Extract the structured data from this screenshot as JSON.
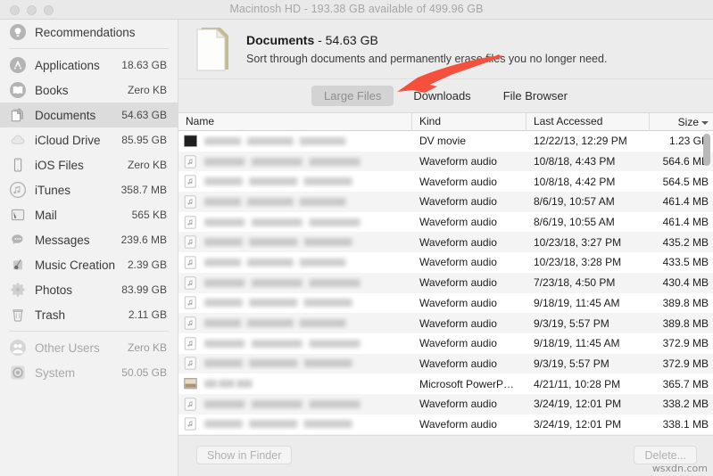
{
  "window": {
    "title": "Macintosh HD - 193.38 GB available of 499.96 GB",
    "traffic_lights": [
      "close",
      "minimize",
      "zoom"
    ],
    "accent_annotation_color": "#f4503c",
    "selection_color": "#dcdcdc"
  },
  "sidebar": {
    "items": [
      {
        "label": "Recommendations",
        "size": "",
        "icon": "lightbulb-icon",
        "selected": false,
        "dim": false,
        "divider_after": true
      },
      {
        "label": "Applications",
        "size": "18.63 GB",
        "icon": "app-store-icon",
        "selected": false,
        "dim": false,
        "divider_after": false
      },
      {
        "label": "Books",
        "size": "Zero KB",
        "icon": "book-icon",
        "selected": false,
        "dim": false,
        "divider_after": false
      },
      {
        "label": "Documents",
        "size": "54.63 GB",
        "icon": "documents-icon",
        "selected": true,
        "dim": false,
        "divider_after": false
      },
      {
        "label": "iCloud Drive",
        "size": "85.95 GB",
        "icon": "cloud-icon",
        "selected": false,
        "dim": false,
        "divider_after": false
      },
      {
        "label": "iOS Files",
        "size": "Zero KB",
        "icon": "iphone-icon",
        "selected": false,
        "dim": false,
        "divider_after": false
      },
      {
        "label": "iTunes",
        "size": "358.7 MB",
        "icon": "music-note-icon",
        "selected": false,
        "dim": false,
        "divider_after": false
      },
      {
        "label": "Mail",
        "size": "565 KB",
        "icon": "mail-icon",
        "selected": false,
        "dim": false,
        "divider_after": false
      },
      {
        "label": "Messages",
        "size": "239.6 MB",
        "icon": "speech-bubble-icon",
        "selected": false,
        "dim": false,
        "divider_after": false
      },
      {
        "label": "Music Creation",
        "size": "2.39 GB",
        "icon": "garageband-icon",
        "selected": false,
        "dim": false,
        "divider_after": false
      },
      {
        "label": "Photos",
        "size": "83.99 GB",
        "icon": "photos-icon",
        "selected": false,
        "dim": false,
        "divider_after": false
      },
      {
        "label": "Trash",
        "size": "2.11 GB",
        "icon": "trash-icon",
        "selected": false,
        "dim": false,
        "divider_after": true
      },
      {
        "label": "Other Users",
        "size": "Zero KB",
        "icon": "users-icon",
        "selected": false,
        "dim": true,
        "divider_after": false
      },
      {
        "label": "System",
        "size": "50.05 GB",
        "icon": "system-gear-icon",
        "selected": false,
        "dim": true,
        "divider_after": false
      }
    ]
  },
  "hero": {
    "icon": "document-file-icon",
    "title_name": "Documents",
    "title_size": " - 54.63 GB",
    "subtitle": "Sort through documents and permanently erase files you no longer need."
  },
  "tabs": [
    {
      "label": "Large Files",
      "active": true
    },
    {
      "label": "Downloads",
      "active": false
    },
    {
      "label": "File Browser",
      "active": false
    }
  ],
  "table": {
    "columns": [
      {
        "key": "name",
        "label": "Name"
      },
      {
        "key": "kind",
        "label": "Kind"
      },
      {
        "key": "date",
        "label": "Last Accessed"
      },
      {
        "key": "size",
        "label": "Size"
      }
    ],
    "sort": {
      "column": "Size",
      "direction": "descending"
    },
    "rows": [
      {
        "name": "",
        "name_redacted": true,
        "icon": "movie-thumbnail-icon",
        "kind": "DV movie",
        "date": "12/22/13, 12:29 PM",
        "size": "1.23 GB"
      },
      {
        "name": "",
        "name_redacted": true,
        "icon": "audio-file-icon",
        "kind": "Waveform audio",
        "date": "10/8/18, 4:43 PM",
        "size": "564.6 MB"
      },
      {
        "name": "",
        "name_redacted": true,
        "icon": "audio-file-icon",
        "kind": "Waveform audio",
        "date": "10/8/18, 4:42 PM",
        "size": "564.5 MB"
      },
      {
        "name": "",
        "name_redacted": true,
        "icon": "audio-file-icon",
        "kind": "Waveform audio",
        "date": "8/6/19, 10:57 AM",
        "size": "461.4 MB"
      },
      {
        "name": "",
        "name_redacted": true,
        "icon": "audio-file-icon",
        "kind": "Waveform audio",
        "date": "8/6/19, 10:55 AM",
        "size": "461.4 MB"
      },
      {
        "name": "",
        "name_redacted": true,
        "icon": "audio-file-icon",
        "kind": "Waveform audio",
        "date": "10/23/18, 3:27 PM",
        "size": "435.2 MB"
      },
      {
        "name": "",
        "name_redacted": true,
        "icon": "audio-file-icon",
        "kind": "Waveform audio",
        "date": "10/23/18, 3:28 PM",
        "size": "433.5 MB"
      },
      {
        "name": "",
        "name_redacted": true,
        "icon": "audio-file-icon",
        "kind": "Waveform audio",
        "date": "7/23/18, 4:50 PM",
        "size": "430.4 MB"
      },
      {
        "name": "",
        "name_redacted": true,
        "icon": "audio-file-icon",
        "kind": "Waveform audio",
        "date": "9/18/19, 11:45 AM",
        "size": "389.8 MB"
      },
      {
        "name": "",
        "name_redacted": true,
        "icon": "audio-file-icon",
        "kind": "Waveform audio",
        "date": "9/3/19, 5:57 PM",
        "size": "389.8 MB"
      },
      {
        "name": "",
        "name_redacted": true,
        "icon": "audio-file-icon",
        "kind": "Waveform audio",
        "date": "9/18/19, 11:45 AM",
        "size": "372.9 MB"
      },
      {
        "name": "",
        "name_redacted": true,
        "icon": "audio-file-icon",
        "kind": "Waveform audio",
        "date": "9/3/19, 5:57 PM",
        "size": "372.9 MB"
      },
      {
        "name": "",
        "name_redacted": true,
        "icon": "powerpoint-icon",
        "kind": "Microsoft PowerP…",
        "date": "4/21/11, 10:28 PM",
        "size": "365.7 MB"
      },
      {
        "name": "",
        "name_redacted": true,
        "icon": "audio-file-icon",
        "kind": "Waveform audio",
        "date": "3/24/19, 12:01 PM",
        "size": "338.2 MB"
      },
      {
        "name": "",
        "name_redacted": true,
        "icon": "audio-file-icon",
        "kind": "Waveform audio",
        "date": "3/24/19, 12:01 PM",
        "size": "338.1 MB"
      },
      {
        "name": "",
        "name_redacted": true,
        "icon": "audio-file-icon",
        "kind": "",
        "date": "",
        "size": ""
      }
    ]
  },
  "footer": {
    "show_in_finder_label": "Show in Finder",
    "delete_label": "Delete...",
    "show_in_finder_enabled": false,
    "delete_enabled": false
  },
  "watermark": "wsxdn.com"
}
